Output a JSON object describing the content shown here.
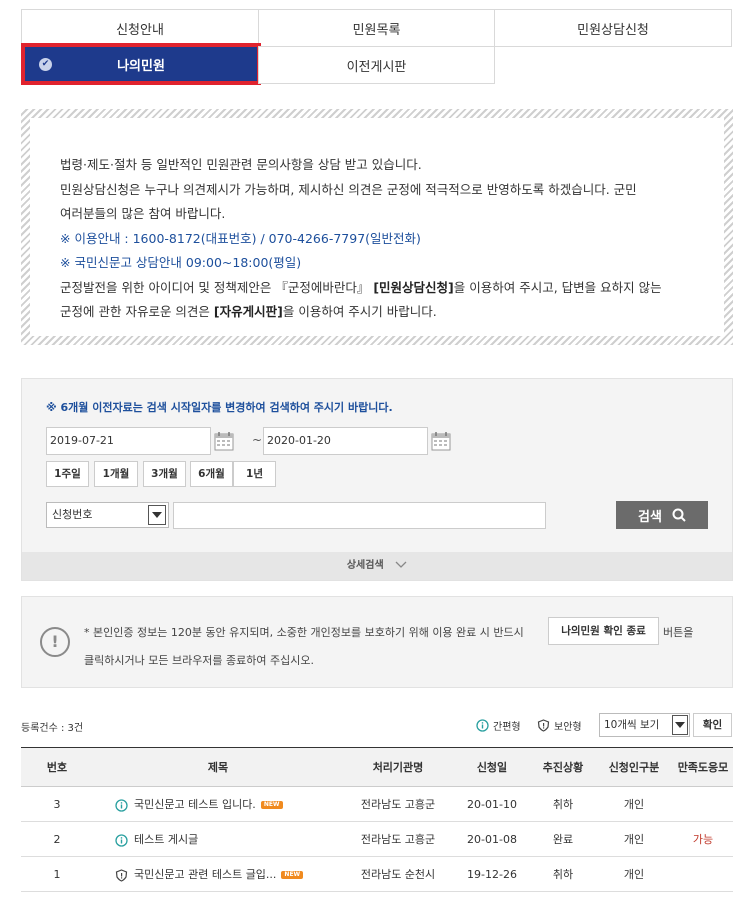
{
  "tabs": [
    {
      "label": "신청안내"
    },
    {
      "label": "민원목록"
    },
    {
      "label": "민원상담신청"
    },
    {
      "label": "나의민원",
      "active": true
    },
    {
      "label": "이전게시판"
    }
  ],
  "notice": {
    "line1": "법령·제도·절차 등 일반적인 민원관련 문의사항을 상담 받고 있습니다.",
    "line2": "민원상담신청은 누구나 의견제시가 가능하며, 제시하신 의견은 군정에 적극적으로 반영하도록 하겠습니다. 군민",
    "line3": "여러분들의 많은 참여 바랍니다.",
    "line4": "※ 이용안내 : 1600-8172(대표번호) / 070-4266-7797(일반전화)",
    "line5": "※ 국민신문고 상담안내 09:00~18:00(평일)",
    "line6_a": "군정발전을 위한 아이디어 및 정책제안은 『군정에바란다』 ",
    "line6_b": "[민원상담신청]",
    "line6_c": "을 이용하여 주시고, 답변을 요하지 않는",
    "line7_a": "군정에 관한 자유로운 의견은 ",
    "line7_b": "[자유게시판]",
    "line7_c": "을 이용하여 주시기 바랍니다."
  },
  "search": {
    "note": "※ 6개월 이전자료는 검색 시작일자를 변경하여 검색하여 주시기 바랍니다.",
    "start_date": "2019-07-21",
    "separator": "~",
    "end_date": "2020-01-20",
    "periods": [
      "1주일",
      "1개월",
      "3개월",
      "6개월",
      "1년"
    ],
    "field_selected": "신청번호",
    "keyword": "",
    "button_label": "검색",
    "detail_label": "상세검색"
  },
  "info": {
    "line1": "* 본인인증 정보는 120분 동안 유지되며, 소중한 개인정보를 보호하기 위해 이용 완료 시 반드시",
    "button_label": "나의민원 확인 종료",
    "after_button": "버튼을",
    "line2": "클릭하시거나 모든 브라우저를 종료하여 주십시오."
  },
  "list": {
    "count_text": "등록건수 : 3건",
    "legend_open": "간편형",
    "legend_secure": "보안형",
    "view_selected": "10개씩 보기",
    "ok_label": "확인",
    "columns": [
      "번호",
      "제목",
      "처리기관명",
      "신청일",
      "추진상황",
      "신청인구분",
      "만족도응모"
    ],
    "rows": [
      {
        "no": "3",
        "type": "open",
        "title": "국민신문고 테스트 입니다.",
        "new": "NEW",
        "agency": "전라남도 고흥군",
        "date": "20-01-10",
        "status": "취하",
        "applicant": "개인",
        "survey": ""
      },
      {
        "no": "2",
        "type": "open",
        "title": "테스트 게시글",
        "new": "",
        "agency": "전라남도 고흥군",
        "date": "20-01-08",
        "status": "완료",
        "applicant": "개인",
        "survey": "가능"
      },
      {
        "no": "1",
        "type": "secure",
        "title": "국민신문고 관련 테스트 글입...",
        "new": "NEW",
        "agency": "전라남도 순천시",
        "date": "19-12-26",
        "status": "취하",
        "applicant": "개인",
        "survey": ""
      }
    ]
  },
  "colors": {
    "accent": "#1e3a8c",
    "highlight_border": "#e0232e",
    "link_blue": "#1d4f9c",
    "open_icon": "#2aa0a0",
    "new_badge": "#f08a1f",
    "survey_red": "#c0392b"
  }
}
